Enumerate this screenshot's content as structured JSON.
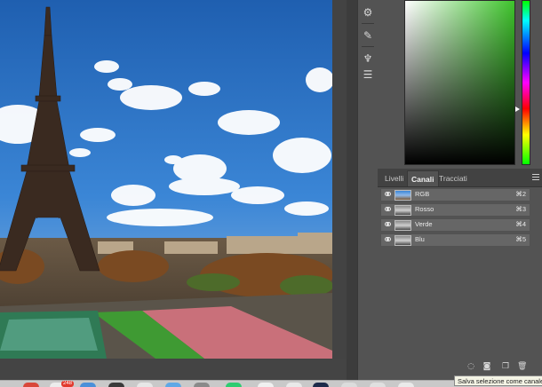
{
  "panel": {
    "tabs": [
      {
        "label": "Livelli",
        "active": false
      },
      {
        "label": "Canali",
        "active": true
      },
      {
        "label": "Tracciati",
        "active": false
      }
    ],
    "channels": [
      {
        "name": "RGB",
        "shortcut": "⌘2",
        "thumbnail": "color"
      },
      {
        "name": "Rosso",
        "shortcut": "⌘3",
        "thumbnail": "grayscale"
      },
      {
        "name": "Verde",
        "shortcut": "⌘4",
        "thumbnail": "grayscale"
      },
      {
        "name": "Blu",
        "shortcut": "⌘5",
        "thumbnail": "grayscale"
      }
    ],
    "bottom_icons": [
      "dotted-circle-icon",
      "mask-icon",
      "new-channel-icon",
      "trash-icon"
    ],
    "tooltip": "Salva selezione come canale"
  },
  "icon_strip": {
    "icons": [
      "properties-icon",
      "brush-settings-icon",
      "adjustments-icon",
      "sliders-icon"
    ]
  },
  "color_picker": {
    "base_hue_color": "#3ec42c"
  },
  "canvas": {
    "subject": "Eiffel Tower photo"
  },
  "dock": {
    "badge": "248"
  },
  "colors": {
    "panel_bg": "#535353",
    "row_bg": "#666666",
    "tab_bar": "#424242"
  }
}
